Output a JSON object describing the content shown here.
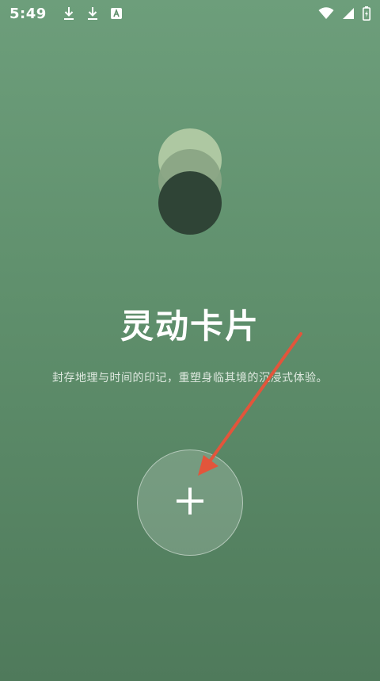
{
  "status_bar": {
    "time": "5:49",
    "icons_left": [
      "download-icon",
      "download-icon",
      "app-notification-icon"
    ],
    "icons_right": [
      "wifi-icon",
      "signal-icon",
      "battery-icon"
    ]
  },
  "hero": {
    "title": "灵动卡片",
    "subtitle": "封存地理与时间的印记，重塑身临其境的沉浸式体验。"
  },
  "add_button": {
    "icon": "plus-icon"
  },
  "colors": {
    "bg_top": "#6d9e7b",
    "bg_bottom": "#4f7a5b",
    "dot_light": "#aec8a2",
    "dot_mid": "#8aa585",
    "dot_dark": "#2f4436",
    "annotation_arrow": "#e2553b"
  }
}
